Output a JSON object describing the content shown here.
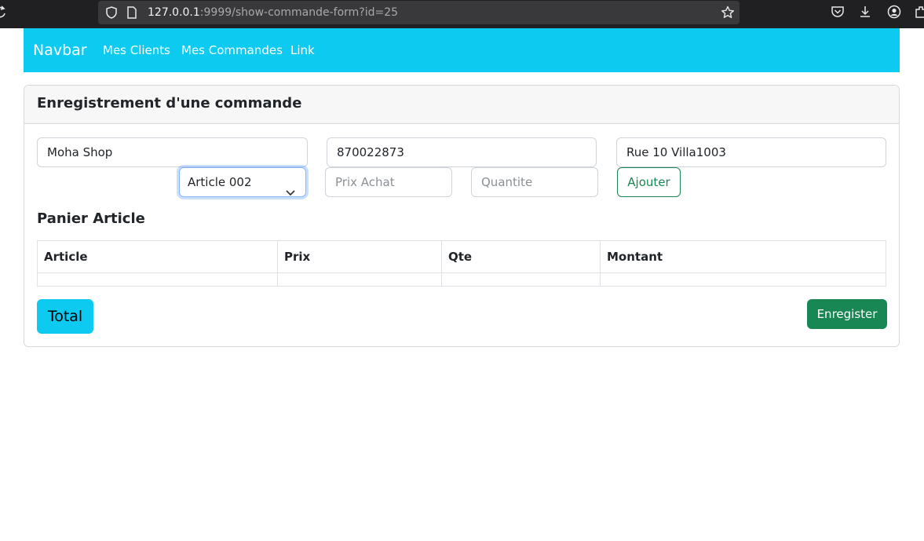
{
  "browser": {
    "url_host": "127.0.0.1",
    "url_rest": ":9999/show-commande-form?id=25",
    "icons": [
      "reload-icon",
      "shield-icon",
      "page-icon",
      "bookmark-star-icon",
      "pocket-icon",
      "download-icon",
      "account-icon",
      "extensions-icon"
    ]
  },
  "navbar": {
    "brand": "Navbar",
    "links": [
      "Mes Clients",
      "Mes Commandes",
      "Link"
    ]
  },
  "card": {
    "title": "Enregistrement d'une commande"
  },
  "form": {
    "client_name": "Moha Shop",
    "client_phone": "870022873",
    "client_address": "Rue 10 Villa1003",
    "article_selected": "Article 002",
    "prix_placeholder": "Prix Achat",
    "quantite_placeholder": "Quantite",
    "ajouter_label": "Ajouter"
  },
  "panier": {
    "title": "Panier Article",
    "columns": [
      "Article",
      "Prix",
      "Qte",
      "Montant"
    ]
  },
  "actions": {
    "total_label": "Total",
    "save_label": "Enregister"
  },
  "colors": {
    "navbar_bg": "#0dcaf0",
    "success": "#198754",
    "focus_border": "#86b7fe"
  }
}
